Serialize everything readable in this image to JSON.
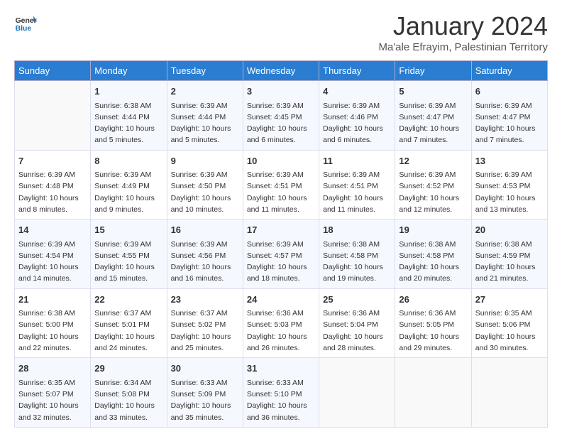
{
  "header": {
    "logo_line1": "General",
    "logo_line2": "Blue",
    "month_title": "January 2024",
    "location": "Ma'ale Efrayim, Palestinian Territory"
  },
  "days_of_week": [
    "Sunday",
    "Monday",
    "Tuesday",
    "Wednesday",
    "Thursday",
    "Friday",
    "Saturday"
  ],
  "weeks": [
    [
      {
        "day": "",
        "info": ""
      },
      {
        "day": "1",
        "info": "Sunrise: 6:38 AM\nSunset: 4:44 PM\nDaylight: 10 hours\nand 5 minutes."
      },
      {
        "day": "2",
        "info": "Sunrise: 6:39 AM\nSunset: 4:44 PM\nDaylight: 10 hours\nand 5 minutes."
      },
      {
        "day": "3",
        "info": "Sunrise: 6:39 AM\nSunset: 4:45 PM\nDaylight: 10 hours\nand 6 minutes."
      },
      {
        "day": "4",
        "info": "Sunrise: 6:39 AM\nSunset: 4:46 PM\nDaylight: 10 hours\nand 6 minutes."
      },
      {
        "day": "5",
        "info": "Sunrise: 6:39 AM\nSunset: 4:47 PM\nDaylight: 10 hours\nand 7 minutes."
      },
      {
        "day": "6",
        "info": "Sunrise: 6:39 AM\nSunset: 4:47 PM\nDaylight: 10 hours\nand 7 minutes."
      }
    ],
    [
      {
        "day": "7",
        "info": "Sunrise: 6:39 AM\nSunset: 4:48 PM\nDaylight: 10 hours\nand 8 minutes."
      },
      {
        "day": "8",
        "info": "Sunrise: 6:39 AM\nSunset: 4:49 PM\nDaylight: 10 hours\nand 9 minutes."
      },
      {
        "day": "9",
        "info": "Sunrise: 6:39 AM\nSunset: 4:50 PM\nDaylight: 10 hours\nand 10 minutes."
      },
      {
        "day": "10",
        "info": "Sunrise: 6:39 AM\nSunset: 4:51 PM\nDaylight: 10 hours\nand 11 minutes."
      },
      {
        "day": "11",
        "info": "Sunrise: 6:39 AM\nSunset: 4:51 PM\nDaylight: 10 hours\nand 11 minutes."
      },
      {
        "day": "12",
        "info": "Sunrise: 6:39 AM\nSunset: 4:52 PM\nDaylight: 10 hours\nand 12 minutes."
      },
      {
        "day": "13",
        "info": "Sunrise: 6:39 AM\nSunset: 4:53 PM\nDaylight: 10 hours\nand 13 minutes."
      }
    ],
    [
      {
        "day": "14",
        "info": "Sunrise: 6:39 AM\nSunset: 4:54 PM\nDaylight: 10 hours\nand 14 minutes."
      },
      {
        "day": "15",
        "info": "Sunrise: 6:39 AM\nSunset: 4:55 PM\nDaylight: 10 hours\nand 15 minutes."
      },
      {
        "day": "16",
        "info": "Sunrise: 6:39 AM\nSunset: 4:56 PM\nDaylight: 10 hours\nand 16 minutes."
      },
      {
        "day": "17",
        "info": "Sunrise: 6:39 AM\nSunset: 4:57 PM\nDaylight: 10 hours\nand 18 minutes."
      },
      {
        "day": "18",
        "info": "Sunrise: 6:38 AM\nSunset: 4:58 PM\nDaylight: 10 hours\nand 19 minutes."
      },
      {
        "day": "19",
        "info": "Sunrise: 6:38 AM\nSunset: 4:58 PM\nDaylight: 10 hours\nand 20 minutes."
      },
      {
        "day": "20",
        "info": "Sunrise: 6:38 AM\nSunset: 4:59 PM\nDaylight: 10 hours\nand 21 minutes."
      }
    ],
    [
      {
        "day": "21",
        "info": "Sunrise: 6:38 AM\nSunset: 5:00 PM\nDaylight: 10 hours\nand 22 minutes."
      },
      {
        "day": "22",
        "info": "Sunrise: 6:37 AM\nSunset: 5:01 PM\nDaylight: 10 hours\nand 24 minutes."
      },
      {
        "day": "23",
        "info": "Sunrise: 6:37 AM\nSunset: 5:02 PM\nDaylight: 10 hours\nand 25 minutes."
      },
      {
        "day": "24",
        "info": "Sunrise: 6:36 AM\nSunset: 5:03 PM\nDaylight: 10 hours\nand 26 minutes."
      },
      {
        "day": "25",
        "info": "Sunrise: 6:36 AM\nSunset: 5:04 PM\nDaylight: 10 hours\nand 28 minutes."
      },
      {
        "day": "26",
        "info": "Sunrise: 6:36 AM\nSunset: 5:05 PM\nDaylight: 10 hours\nand 29 minutes."
      },
      {
        "day": "27",
        "info": "Sunrise: 6:35 AM\nSunset: 5:06 PM\nDaylight: 10 hours\nand 30 minutes."
      }
    ],
    [
      {
        "day": "28",
        "info": "Sunrise: 6:35 AM\nSunset: 5:07 PM\nDaylight: 10 hours\nand 32 minutes."
      },
      {
        "day": "29",
        "info": "Sunrise: 6:34 AM\nSunset: 5:08 PM\nDaylight: 10 hours\nand 33 minutes."
      },
      {
        "day": "30",
        "info": "Sunrise: 6:33 AM\nSunset: 5:09 PM\nDaylight: 10 hours\nand 35 minutes."
      },
      {
        "day": "31",
        "info": "Sunrise: 6:33 AM\nSunset: 5:10 PM\nDaylight: 10 hours\nand 36 minutes."
      },
      {
        "day": "",
        "info": ""
      },
      {
        "day": "",
        "info": ""
      },
      {
        "day": "",
        "info": ""
      }
    ]
  ]
}
